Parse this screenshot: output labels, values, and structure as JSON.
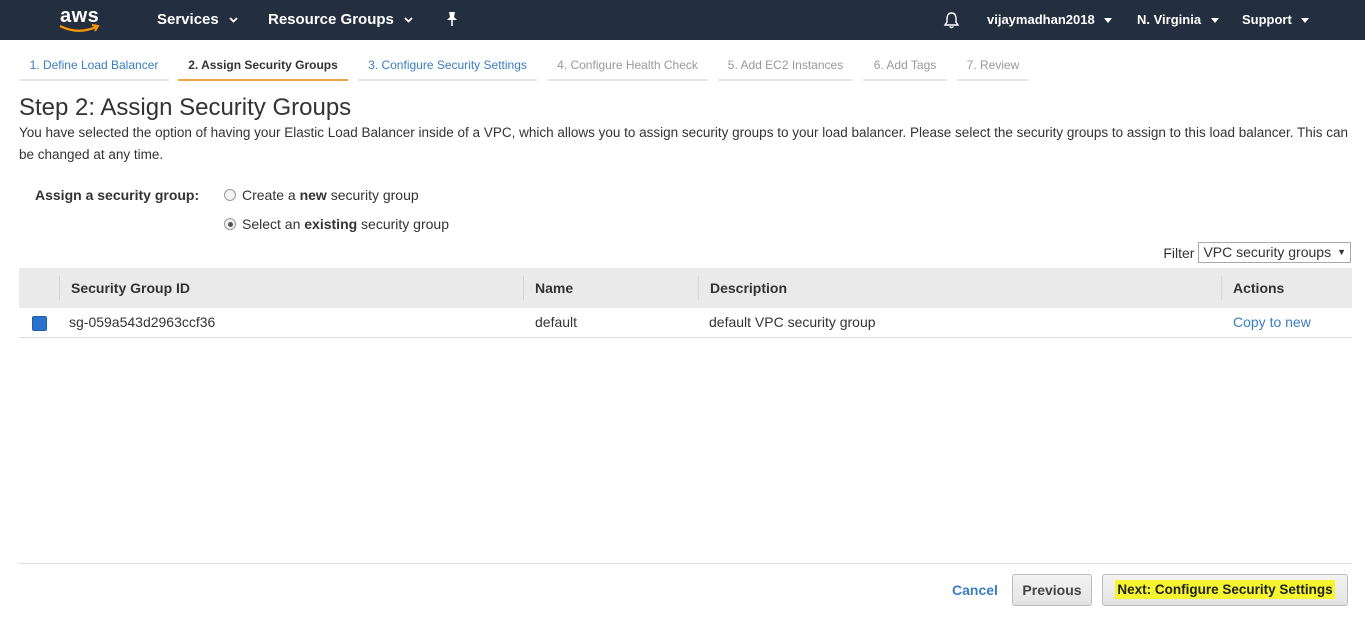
{
  "nav": {
    "logo": "aws",
    "services": "Services",
    "resource_groups": "Resource Groups",
    "user": "vijaymadhan2018",
    "region": "N. Virginia",
    "support": "Support"
  },
  "tabs": [
    {
      "label": "1. Define Load Balancer"
    },
    {
      "label": "2. Assign Security Groups"
    },
    {
      "label": "3. Configure Security Settings"
    },
    {
      "label": "4. Configure Health Check"
    },
    {
      "label": "5. Add EC2 Instances"
    },
    {
      "label": "6. Add Tags"
    },
    {
      "label": "7. Review"
    }
  ],
  "page": {
    "title": "Step 2: Assign Security Groups",
    "intro": "You have selected the option of having your Elastic Load Balancer inside of a VPC, which allows you to assign security groups to your load balancer. Please select the security groups to assign to this load balancer. This can be changed at any time."
  },
  "assign": {
    "label": "Assign a security group:",
    "option_new": {
      "pre": "Create a ",
      "bold": "new",
      "post": " security group",
      "selected": false
    },
    "option_existing": {
      "pre": "Select an ",
      "bold": "existing",
      "post": " security group",
      "selected": true
    }
  },
  "filter": {
    "label": "Filter",
    "value": "VPC security groups"
  },
  "table": {
    "headers": [
      "Security Group ID",
      "Name",
      "Description",
      "Actions"
    ],
    "rows": [
      {
        "checked": true,
        "id": "sg-059a543d2963ccf36",
        "name": "default",
        "description": "default VPC security group",
        "action": "Copy to new"
      }
    ]
  },
  "footer": {
    "cancel": "Cancel",
    "previous": "Previous",
    "next": "Next: Configure Security Settings"
  },
  "colors": {
    "nav_bg": "#232f3e",
    "link": "#3a7dc0",
    "active_tab_underline": "#f0a247",
    "highlight": "#f5f530"
  }
}
